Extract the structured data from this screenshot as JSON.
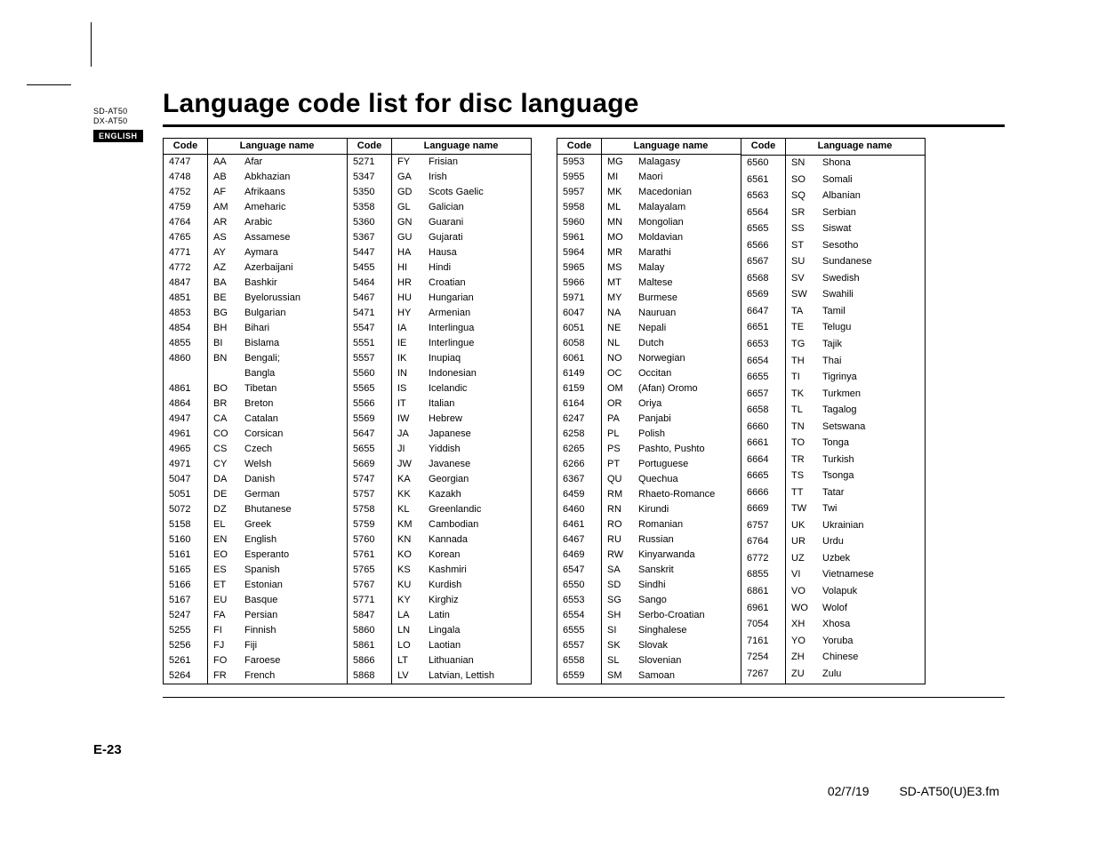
{
  "side": {
    "model1": "SD-AT50",
    "model2": "DX-AT50",
    "lang": "ENGLISH"
  },
  "title": "Language code list for disc language",
  "headers": {
    "code": "Code",
    "name": "Language name"
  },
  "pageNum": "E-23",
  "footer": {
    "date": "02/7/19",
    "file": "SD-AT50(U)E3.fm"
  },
  "cols": [
    [
      {
        "c": "4747",
        "i": "AA",
        "n": "Afar"
      },
      {
        "c": "4748",
        "i": "AB",
        "n": "Abkhazian"
      },
      {
        "c": "4752",
        "i": "AF",
        "n": "Afrikaans"
      },
      {
        "c": "4759",
        "i": "AM",
        "n": "Ameharic"
      },
      {
        "c": "4764",
        "i": "AR",
        "n": "Arabic"
      },
      {
        "c": "4765",
        "i": "AS",
        "n": "Assamese"
      },
      {
        "c": "4771",
        "i": "AY",
        "n": "Aymara"
      },
      {
        "c": "4772",
        "i": "AZ",
        "n": "Azerbaijani"
      },
      {
        "c": "4847",
        "i": "BA",
        "n": "Bashkir"
      },
      {
        "c": "4851",
        "i": "BE",
        "n": "Byelorussian"
      },
      {
        "c": "4853",
        "i": "BG",
        "n": "Bulgarian"
      },
      {
        "c": "4854",
        "i": "BH",
        "n": "Bihari"
      },
      {
        "c": "4855",
        "i": "BI",
        "n": "Bislama"
      },
      {
        "c": "4860",
        "i": "BN",
        "n": "Bengali;"
      },
      {
        "c": "",
        "i": "",
        "n": "Bangla"
      },
      {
        "c": "4861",
        "i": "BO",
        "n": "Tibetan"
      },
      {
        "c": "4864",
        "i": "BR",
        "n": "Breton"
      },
      {
        "c": "4947",
        "i": "CA",
        "n": "Catalan"
      },
      {
        "c": "4961",
        "i": "CO",
        "n": "Corsican"
      },
      {
        "c": "4965",
        "i": "CS",
        "n": "Czech"
      },
      {
        "c": "4971",
        "i": "CY",
        "n": "Welsh"
      },
      {
        "c": "5047",
        "i": "DA",
        "n": "Danish"
      },
      {
        "c": "5051",
        "i": "DE",
        "n": "German"
      },
      {
        "c": "5072",
        "i": "DZ",
        "n": "Bhutanese"
      },
      {
        "c": "5158",
        "i": "EL",
        "n": "Greek"
      },
      {
        "c": "5160",
        "i": "EN",
        "n": "English"
      },
      {
        "c": "5161",
        "i": "EO",
        "n": "Esperanto"
      },
      {
        "c": "5165",
        "i": "ES",
        "n": "Spanish"
      },
      {
        "c": "5166",
        "i": "ET",
        "n": "Estonian"
      },
      {
        "c": "5167",
        "i": "EU",
        "n": "Basque"
      },
      {
        "c": "5247",
        "i": "FA",
        "n": "Persian"
      },
      {
        "c": "5255",
        "i": "FI",
        "n": "Finnish"
      },
      {
        "c": "5256",
        "i": "FJ",
        "n": "Fiji"
      },
      {
        "c": "5261",
        "i": "FO",
        "n": "Faroese"
      },
      {
        "c": "5264",
        "i": "FR",
        "n": "French"
      }
    ],
    [
      {
        "c": "5271",
        "i": "FY",
        "n": "Frisian"
      },
      {
        "c": "5347",
        "i": "GA",
        "n": "Irish"
      },
      {
        "c": "5350",
        "i": "GD",
        "n": "Scots Gaelic"
      },
      {
        "c": "5358",
        "i": "GL",
        "n": "Galician"
      },
      {
        "c": "5360",
        "i": "GN",
        "n": "Guarani"
      },
      {
        "c": "5367",
        "i": "GU",
        "n": "Gujarati"
      },
      {
        "c": "5447",
        "i": "HA",
        "n": "Hausa"
      },
      {
        "c": "5455",
        "i": "HI",
        "n": "Hindi"
      },
      {
        "c": "5464",
        "i": "HR",
        "n": "Croatian"
      },
      {
        "c": "5467",
        "i": "HU",
        "n": "Hungarian"
      },
      {
        "c": "5471",
        "i": "HY",
        "n": "Armenian"
      },
      {
        "c": "5547",
        "i": "IA",
        "n": "Interlingua"
      },
      {
        "c": "5551",
        "i": "IE",
        "n": "Interlingue"
      },
      {
        "c": "5557",
        "i": "IK",
        "n": "Inupiaq"
      },
      {
        "c": "5560",
        "i": "IN",
        "n": "Indonesian"
      },
      {
        "c": "5565",
        "i": "IS",
        "n": "Icelandic"
      },
      {
        "c": "5566",
        "i": "IT",
        "n": "Italian"
      },
      {
        "c": "5569",
        "i": "IW",
        "n": "Hebrew"
      },
      {
        "c": "5647",
        "i": "JA",
        "n": "Japanese"
      },
      {
        "c": "5655",
        "i": "JI",
        "n": "Yiddish"
      },
      {
        "c": "5669",
        "i": "JW",
        "n": "Javanese"
      },
      {
        "c": "5747",
        "i": "KA",
        "n": "Georgian"
      },
      {
        "c": "5757",
        "i": "KK",
        "n": "Kazakh"
      },
      {
        "c": "5758",
        "i": "KL",
        "n": "Greenlandic"
      },
      {
        "c": "5759",
        "i": "KM",
        "n": "Cambodian"
      },
      {
        "c": "5760",
        "i": "KN",
        "n": "Kannada"
      },
      {
        "c": "5761",
        "i": "KO",
        "n": "Korean"
      },
      {
        "c": "5765",
        "i": "KS",
        "n": "Kashmiri"
      },
      {
        "c": "5767",
        "i": "KU",
        "n": "Kurdish"
      },
      {
        "c": "5771",
        "i": "KY",
        "n": "Kirghiz"
      },
      {
        "c": "5847",
        "i": "LA",
        "n": "Latin"
      },
      {
        "c": "5860",
        "i": "LN",
        "n": "Lingala"
      },
      {
        "c": "5861",
        "i": "LO",
        "n": "Laotian"
      },
      {
        "c": "5866",
        "i": "LT",
        "n": "Lithuanian"
      },
      {
        "c": "5868",
        "i": "LV",
        "n": "Latvian, Lettish"
      }
    ],
    [
      {
        "c": "5953",
        "i": "MG",
        "n": "Malagasy"
      },
      {
        "c": "5955",
        "i": "MI",
        "n": "Maori"
      },
      {
        "c": "5957",
        "i": "MK",
        "n": "Macedonian"
      },
      {
        "c": "5958",
        "i": "ML",
        "n": "Malayalam"
      },
      {
        "c": "5960",
        "i": "MN",
        "n": "Mongolian"
      },
      {
        "c": "5961",
        "i": "MO",
        "n": "Moldavian"
      },
      {
        "c": "5964",
        "i": "MR",
        "n": "Marathi"
      },
      {
        "c": "5965",
        "i": "MS",
        "n": "Malay"
      },
      {
        "c": "5966",
        "i": "MT",
        "n": "Maltese"
      },
      {
        "c": "5971",
        "i": "MY",
        "n": "Burmese"
      },
      {
        "c": "6047",
        "i": "NA",
        "n": "Nauruan"
      },
      {
        "c": "6051",
        "i": "NE",
        "n": "Nepali"
      },
      {
        "c": "6058",
        "i": "NL",
        "n": "Dutch"
      },
      {
        "c": "6061",
        "i": "NO",
        "n": "Norwegian"
      },
      {
        "c": "6149",
        "i": "OC",
        "n": "Occitan"
      },
      {
        "c": "6159",
        "i": "OM",
        "n": "(Afan) Oromo"
      },
      {
        "c": "6164",
        "i": "OR",
        "n": "Oriya"
      },
      {
        "c": "6247",
        "i": "PA",
        "n": "Panjabi"
      },
      {
        "c": "6258",
        "i": "PL",
        "n": "Polish"
      },
      {
        "c": "6265",
        "i": "PS",
        "n": "Pashto, Pushto"
      },
      {
        "c": "6266",
        "i": "PT",
        "n": "Portuguese"
      },
      {
        "c": "6367",
        "i": "QU",
        "n": "Quechua"
      },
      {
        "c": "6459",
        "i": "RM",
        "n": "Rhaeto-Romance"
      },
      {
        "c": "6460",
        "i": "RN",
        "n": "Kirundi"
      },
      {
        "c": "6461",
        "i": "RO",
        "n": "Romanian"
      },
      {
        "c": "6467",
        "i": "RU",
        "n": "Russian"
      },
      {
        "c": "6469",
        "i": "RW",
        "n": "Kinyarwanda"
      },
      {
        "c": "6547",
        "i": "SA",
        "n": "Sanskrit"
      },
      {
        "c": "6550",
        "i": "SD",
        "n": "Sindhi"
      },
      {
        "c": "6553",
        "i": "SG",
        "n": "Sango"
      },
      {
        "c": "6554",
        "i": "SH",
        "n": "Serbo-Croatian"
      },
      {
        "c": "6555",
        "i": "SI",
        "n": "Singhalese"
      },
      {
        "c": "6557",
        "i": "SK",
        "n": "Slovak"
      },
      {
        "c": "6558",
        "i": "SL",
        "n": "Slovenian"
      },
      {
        "c": "6559",
        "i": "SM",
        "n": "Samoan"
      }
    ],
    [
      {
        "c": "6560",
        "i": "SN",
        "n": "Shona"
      },
      {
        "c": "6561",
        "i": "SO",
        "n": "Somali"
      },
      {
        "c": "6563",
        "i": "SQ",
        "n": "Albanian"
      },
      {
        "c": "6564",
        "i": "SR",
        "n": "Serbian"
      },
      {
        "c": "6565",
        "i": "SS",
        "n": "Siswat"
      },
      {
        "c": "6566",
        "i": "ST",
        "n": "Sesotho"
      },
      {
        "c": "6567",
        "i": "SU",
        "n": "Sundanese"
      },
      {
        "c": "6568",
        "i": "SV",
        "n": "Swedish"
      },
      {
        "c": "6569",
        "i": "SW",
        "n": "Swahili"
      },
      {
        "c": "6647",
        "i": "TA",
        "n": "Tamil"
      },
      {
        "c": "6651",
        "i": "TE",
        "n": "Telugu"
      },
      {
        "c": "6653",
        "i": "TG",
        "n": "Tajik"
      },
      {
        "c": "6654",
        "i": "TH",
        "n": "Thai"
      },
      {
        "c": "6655",
        "i": "TI",
        "n": "Tigrinya"
      },
      {
        "c": "6657",
        "i": "TK",
        "n": "Turkmen"
      },
      {
        "c": "6658",
        "i": "TL",
        "n": "Tagalog"
      },
      {
        "c": "6660",
        "i": "TN",
        "n": "Setswana"
      },
      {
        "c": "6661",
        "i": "TO",
        "n": "Tonga"
      },
      {
        "c": "6664",
        "i": "TR",
        "n": "Turkish"
      },
      {
        "c": "6665",
        "i": "TS",
        "n": "Tsonga"
      },
      {
        "c": "6666",
        "i": "TT",
        "n": "Tatar"
      },
      {
        "c": "6669",
        "i": "TW",
        "n": "Twi"
      },
      {
        "c": "6757",
        "i": "UK",
        "n": "Ukrainian"
      },
      {
        "c": "6764",
        "i": "UR",
        "n": "Urdu"
      },
      {
        "c": "6772",
        "i": "UZ",
        "n": "Uzbek"
      },
      {
        "c": "6855",
        "i": "VI",
        "n": "Vietnamese"
      },
      {
        "c": "6861",
        "i": "VO",
        "n": "Volapuk"
      },
      {
        "c": "6961",
        "i": "WO",
        "n": "Wolof"
      },
      {
        "c": "7054",
        "i": "XH",
        "n": "Xhosa"
      },
      {
        "c": "7161",
        "i": "YO",
        "n": "Yoruba"
      },
      {
        "c": "7254",
        "i": "ZH",
        "n": "Chinese"
      },
      {
        "c": "7267",
        "i": "ZU",
        "n": "Zulu"
      }
    ]
  ]
}
